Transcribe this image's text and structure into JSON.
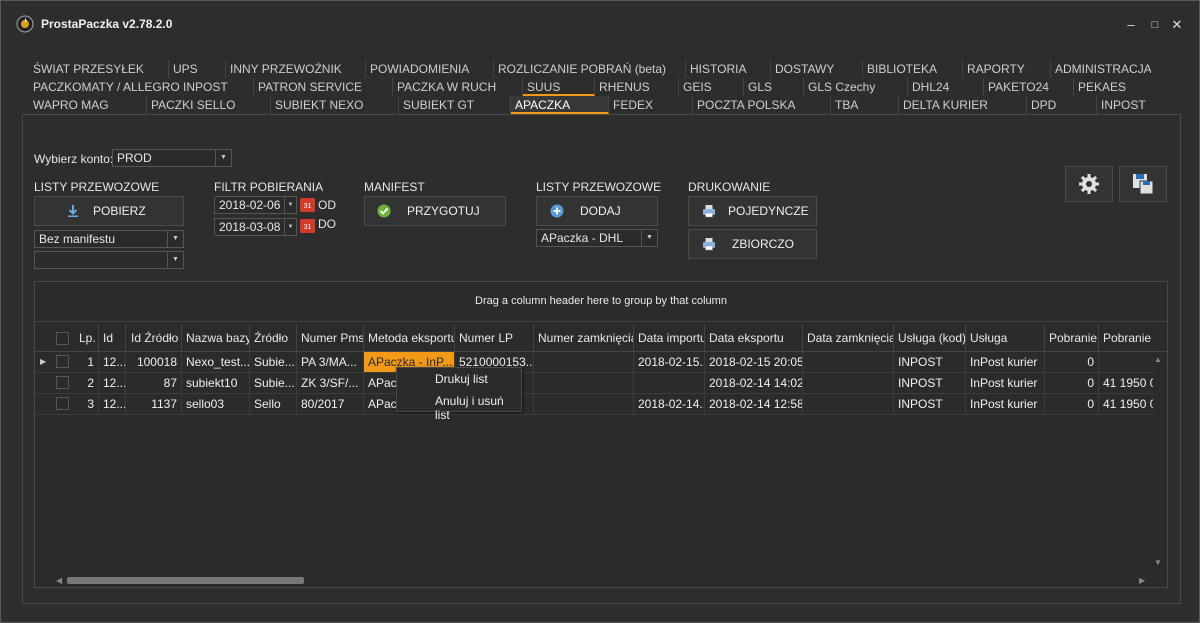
{
  "app": {
    "title": "ProstaPaczka v2.78.2.0"
  },
  "window_controls": [
    "–",
    "□",
    "✕"
  ],
  "tabs": {
    "row1": [
      "ŚWIAT PRZESYŁEK",
      "UPS",
      "INNY PRZEWOŹNIK",
      "POWIADOMIENIA",
      "ROZLICZANIE POBRAŃ (beta)",
      "HISTORIA",
      "DOSTAWY",
      "BIBLIOTEKA",
      "RAPORTY",
      "ADMINISTRACJA"
    ],
    "row2": [
      "PACZKOMATY / ALLEGRO INPOST",
      "PATRON SERVICE",
      "PACZKA W RUCH",
      "SUUS",
      "RHENUS",
      "GEIS",
      "GLS",
      "GLS Czechy",
      "DHL24",
      "PAKETO24",
      "PEKAES"
    ],
    "row3": [
      "WAPRO MAG",
      "PACZKI SELLO",
      "SUBIEKT NEXO",
      "SUBIEKT GT",
      "APACZKA",
      "FEDEX",
      "POCZTA POLSKA",
      "TBA",
      "DELTA KURIER",
      "DPD",
      "INPOST"
    ],
    "active": "APACZKA"
  },
  "account": {
    "label": "Wybierz konto:",
    "value": "PROD"
  },
  "listy_przewozowe_left": {
    "heading": "LISTY PRZEWOZOWE",
    "button": "POBIERZ",
    "filter_value": "Bez manifestu",
    "second_filter_value": ""
  },
  "filtr": {
    "heading": "FILTR POBIERANIA",
    "date_from": "2018-02-06",
    "label_from": "OD",
    "date_to": "2018-03-08",
    "label_to": "DO",
    "calendar_text": "31"
  },
  "manifest": {
    "heading": "MANIFEST",
    "button": "PRZYGOTUJ"
  },
  "listy_przewozowe_right": {
    "heading": "LISTY PRZEWOZOWE",
    "button": "DODAJ",
    "carrier_value": "APaczka -  DHL"
  },
  "drukowanie": {
    "heading": "DRUKOWANIE",
    "button_single": "POJEDYNCZE",
    "button_bulk": "ZBIORCZO"
  },
  "grid": {
    "group_hint": "Drag a column header here to group by that column",
    "columns": [
      "Lp.",
      "Id",
      "Id Źródło",
      "Nazwa bazy",
      "Źródło",
      "Numer Pms",
      "Metoda eksportu",
      "Numer LP",
      "Numer zamknięcia",
      "Data importu",
      "Data eksportu",
      "Data zamknięcia",
      "Usługa (kod)",
      "Usługa",
      "Pobranie",
      "Pobranie"
    ],
    "rows": [
      [
        "1",
        "12...",
        "100018",
        "Nexo_test...",
        "Subie...",
        "PA 3/MA...",
        "APaczka - InP...",
        "5210000153...",
        "",
        "2018-02-15...",
        "2018-02-15 20:05",
        "",
        "INPOST",
        "InPost kurier",
        "0",
        ""
      ],
      [
        "2",
        "12...",
        "87",
        "subiekt10",
        "Subie...",
        "ZK 3/SF/...",
        "APac",
        "",
        "",
        "",
        "2018-02-14 14:02",
        "",
        "INPOST",
        "InPost kurier",
        "0",
        "41 1950 0"
      ],
      [
        "3",
        "12...",
        "1137",
        "sello03",
        "Sello",
        "80/2017",
        "APac",
        "",
        "",
        "2018-02-14...",
        "2018-02-14 12:58",
        "",
        "INPOST",
        "InPost kurier",
        "0",
        "41 1950 0"
      ]
    ]
  },
  "context_menu": [
    "Drukuj list",
    "Anuluj i usuń list"
  ],
  "colors": {
    "accent": "#f29a17",
    "background": "#2d2d2d",
    "selected_cell": "#f29a17"
  },
  "icons": [
    "app-logo-icon",
    "download-icon",
    "check-icon",
    "add-icon",
    "printer-icon",
    "gear-icon",
    "save-icon",
    "calendar-icon"
  ]
}
